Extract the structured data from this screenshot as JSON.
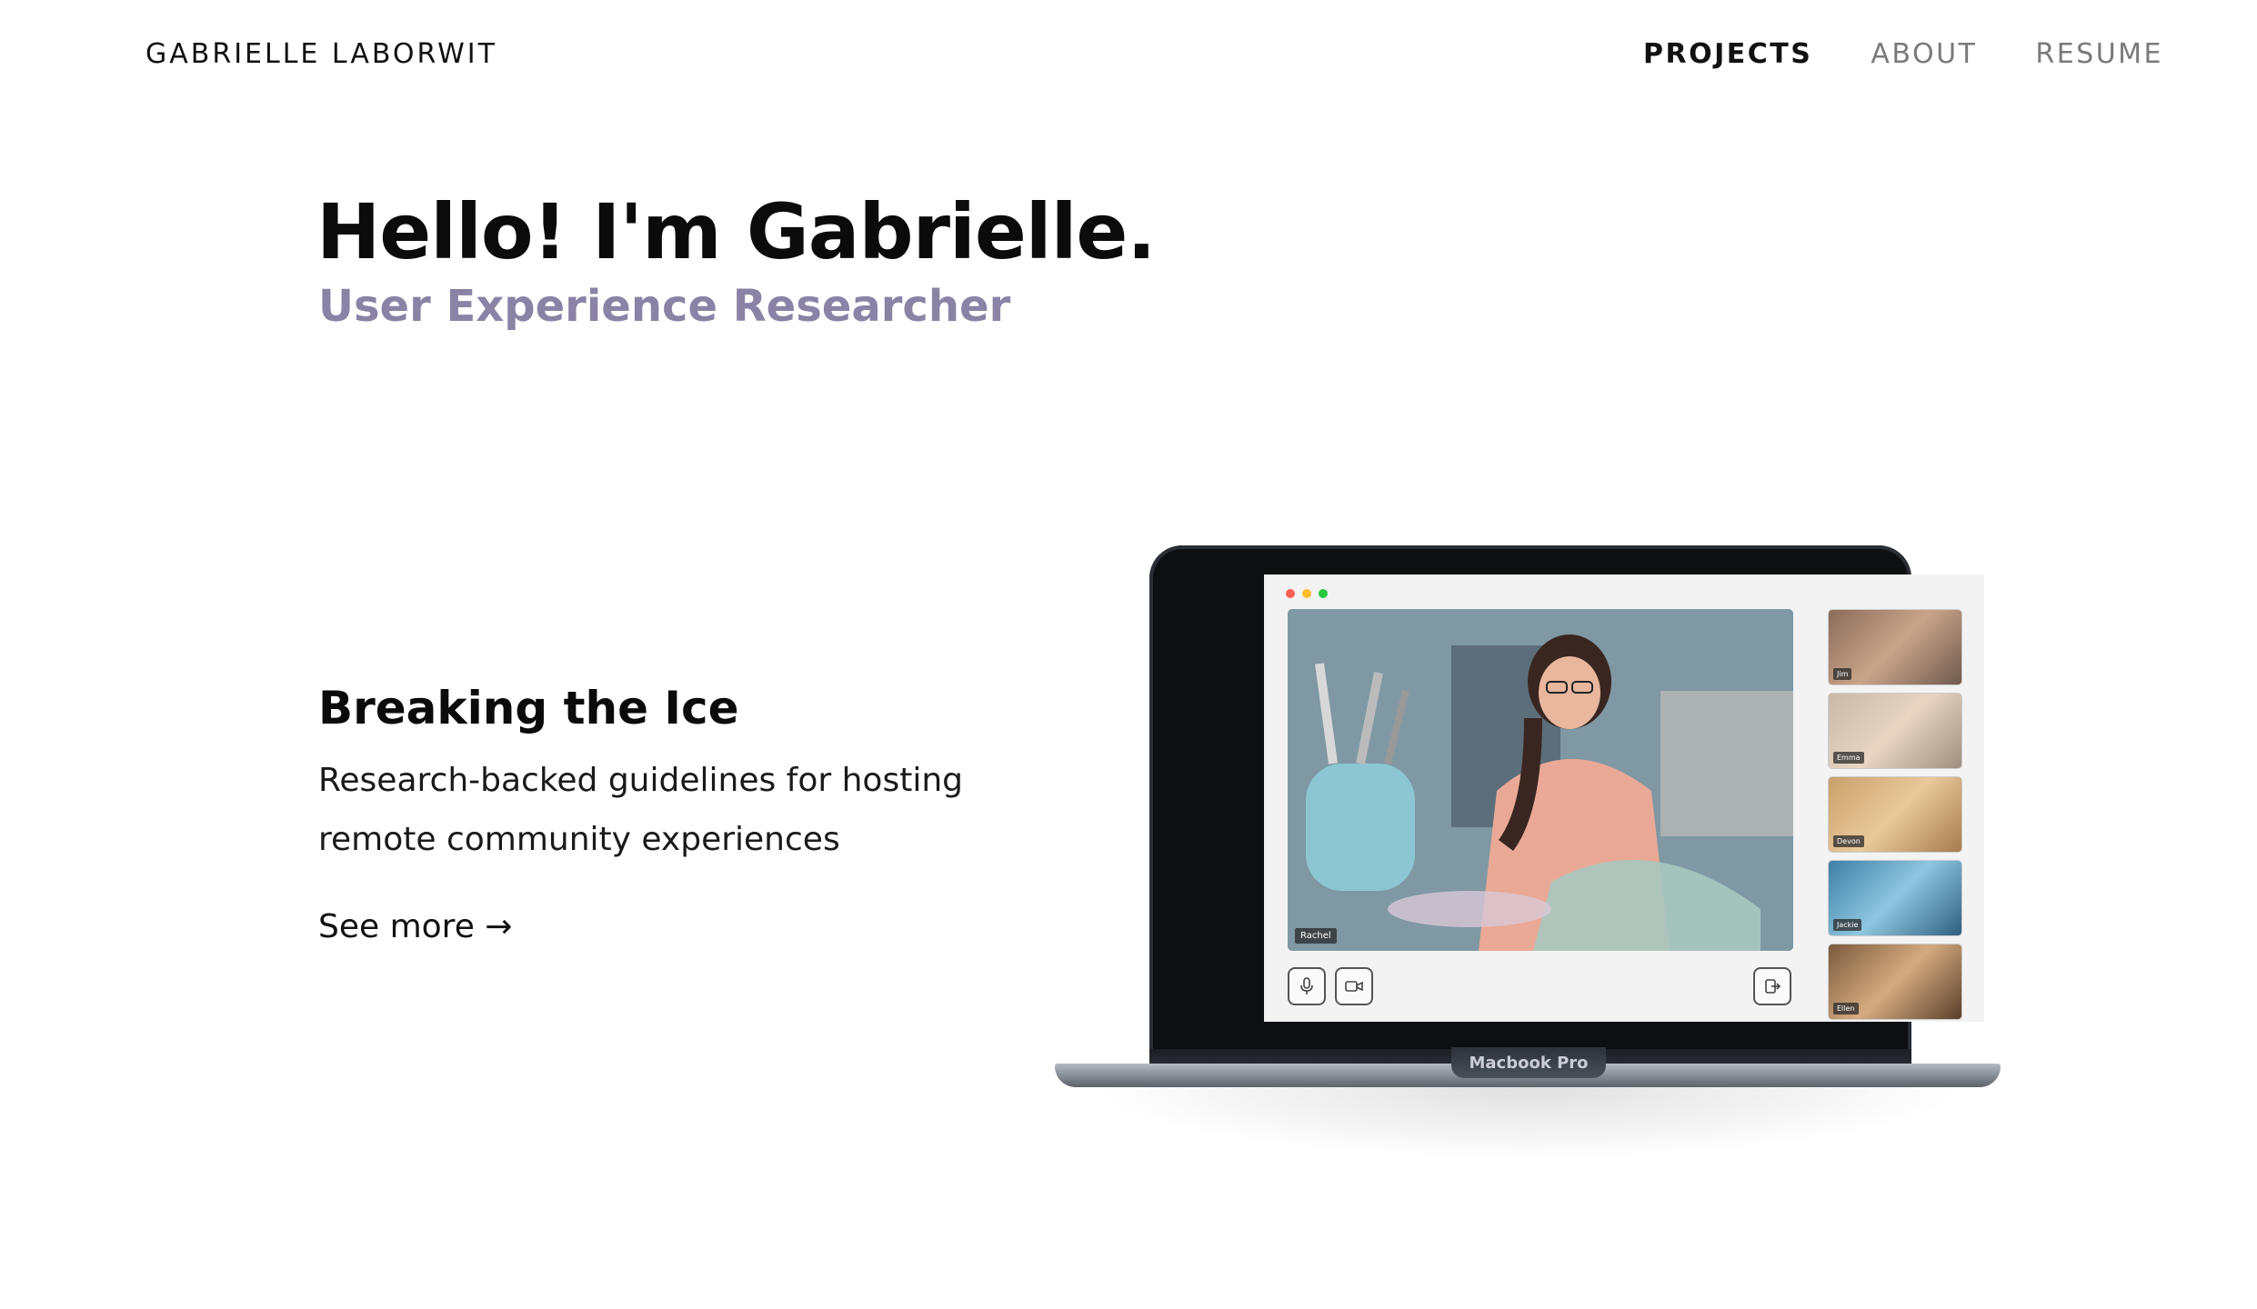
{
  "nav": {
    "brand": "GABRIELLE LABORWIT",
    "links": [
      {
        "label": "PROJECTS",
        "active": true
      },
      {
        "label": "ABOUT",
        "active": false
      },
      {
        "label": "RESUME",
        "active": false
      }
    ]
  },
  "hero": {
    "title": "Hello! I'm Gabrielle.",
    "subtitle": "User Experience Researcher"
  },
  "project": {
    "title": "Breaking the Ice",
    "description": "Research-backed guidelines for hosting remote community experiences",
    "cta": "See more →"
  },
  "mockup": {
    "laptop_label": "Macbook Pro",
    "main_speaker": "Rachel",
    "participants": [
      "Jim",
      "Emma",
      "Devon",
      "Jackie",
      "Ellen"
    ],
    "icons": [
      "microphone-icon",
      "video-camera-icon",
      "leave-call-icon"
    ]
  },
  "colors": {
    "subtitle": "#8a83a6",
    "text": "#111111",
    "nav_inactive": "#7a7a7a"
  }
}
